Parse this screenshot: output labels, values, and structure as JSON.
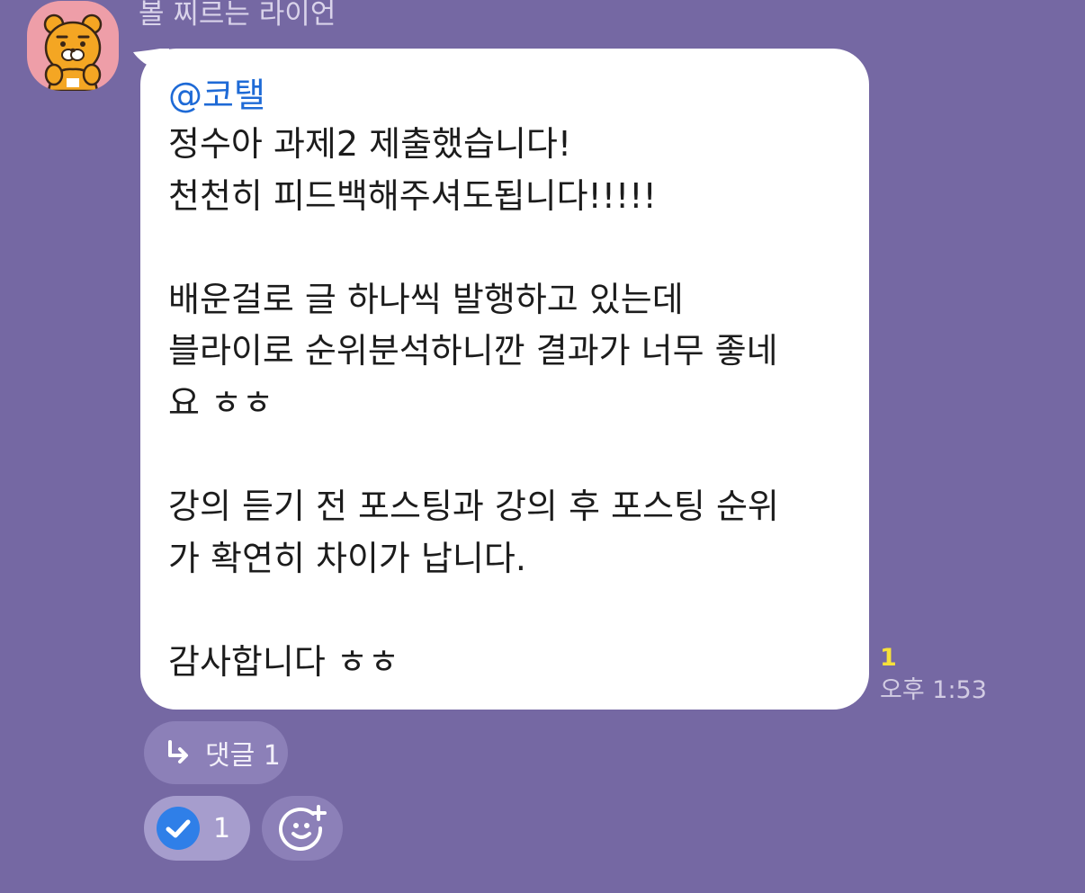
{
  "message": {
    "sender_name": "볼 찌르는 라이언",
    "mention": "@코탤",
    "lines": [
      "정수아 과제2 제출했습니다!",
      "천천히 피드백해주셔도됩니다!!!!!",
      "",
      "배운걸로 글 하나씩 발행하고 있는데",
      "블라이로 순위분석하니깐 결과가 너무 좋네",
      "요 ㅎㅎ",
      "",
      "강의 듣기 전 포스팅과 강의 후 포스팅 순위",
      "가 확연히 차이가 납니다.",
      "",
      "감사합니다 ㅎㅎ"
    ],
    "unread_count": "1",
    "time": "오후 1:53"
  },
  "reply": {
    "label": "댓글 1",
    "icon": "reply-arrow-icon"
  },
  "reactions": {
    "check_count": "1",
    "check_icon": "check-circle-icon",
    "add_icon": "add-emoji-icon"
  },
  "colors": {
    "background": "#7568a3",
    "bubble": "#ffffff",
    "mention": "#1e6ad6",
    "unread": "#f7e13a",
    "check": "#2f7fe8"
  }
}
